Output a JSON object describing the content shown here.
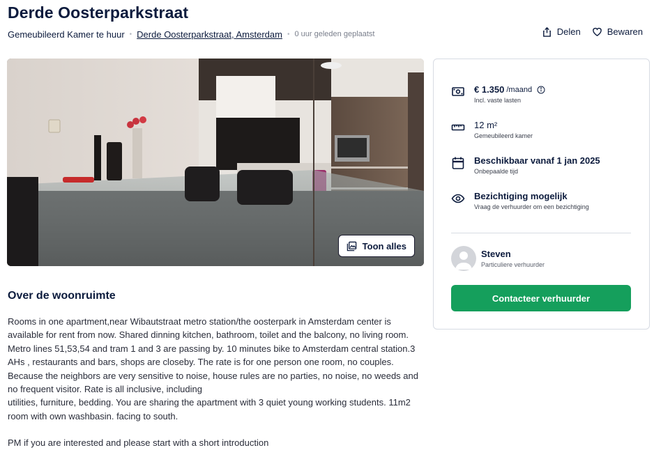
{
  "listing": {
    "title": "Derde Oosterparkstraat",
    "type": "Gemeubileerd Kamer te huur",
    "address": "Derde Oosterparkstraat, Amsterdam",
    "posted": "0 uur geleden geplaatst"
  },
  "actions": {
    "share_label": "Delen",
    "save_label": "Bewaren"
  },
  "gallery": {
    "show_all_label": "Toon alles"
  },
  "about": {
    "heading": "Over de woonruimte",
    "paragraph1": "Rooms in one apartment,near Wibautstraat metro station/the oosterpark in Amsterdam center is available for rent from now. Shared dinning kitchen, bathroom, toilet and the balcony, no living room. Metro lines 51,53,54 and tram 1 and 3 are passing by. 10 minutes bike to Amsterdam central station.3 AHs , restaurants and bars, shops are closeby. The rate is for one person one room, no couples. Because the neighbors are very sensitive to noise, house rules are no parties, no noise, no weeds and no frequent visitor. Rate is all inclusive, including\nutilities, furniture, bedding.  You are sharing the apartment with 3 quiet young working students. 11m2 room with own washbasin. facing to south.",
    "paragraph2": "PM if you are interested and please start with a short introduction"
  },
  "facts": {
    "price": {
      "value": "€ 1.350",
      "unit": "/maand",
      "note": "Incl. vaste lasten",
      "icon": "banknote-icon"
    },
    "size": {
      "value": "12 m²",
      "note": "Gemeubileerd kamer",
      "icon": "ruler-icon"
    },
    "availability": {
      "value": "Beschikbaar vanaf 1 jan 2025",
      "note": "Onbepaalde tijd",
      "icon": "calendar-icon"
    },
    "viewing": {
      "value": "Bezichtiging mogelijk",
      "note": "Vraag de verhuurder om een bezichtiging",
      "icon": "eye-icon"
    }
  },
  "host": {
    "name": "Steven",
    "role": "Particuliere verhuurder"
  },
  "contact": {
    "label": "Contacteer verhuurder"
  },
  "colors": {
    "primary_text": "#0c1b3d",
    "contact_button": "#159f5c",
    "card_border": "#d7dbe3"
  }
}
